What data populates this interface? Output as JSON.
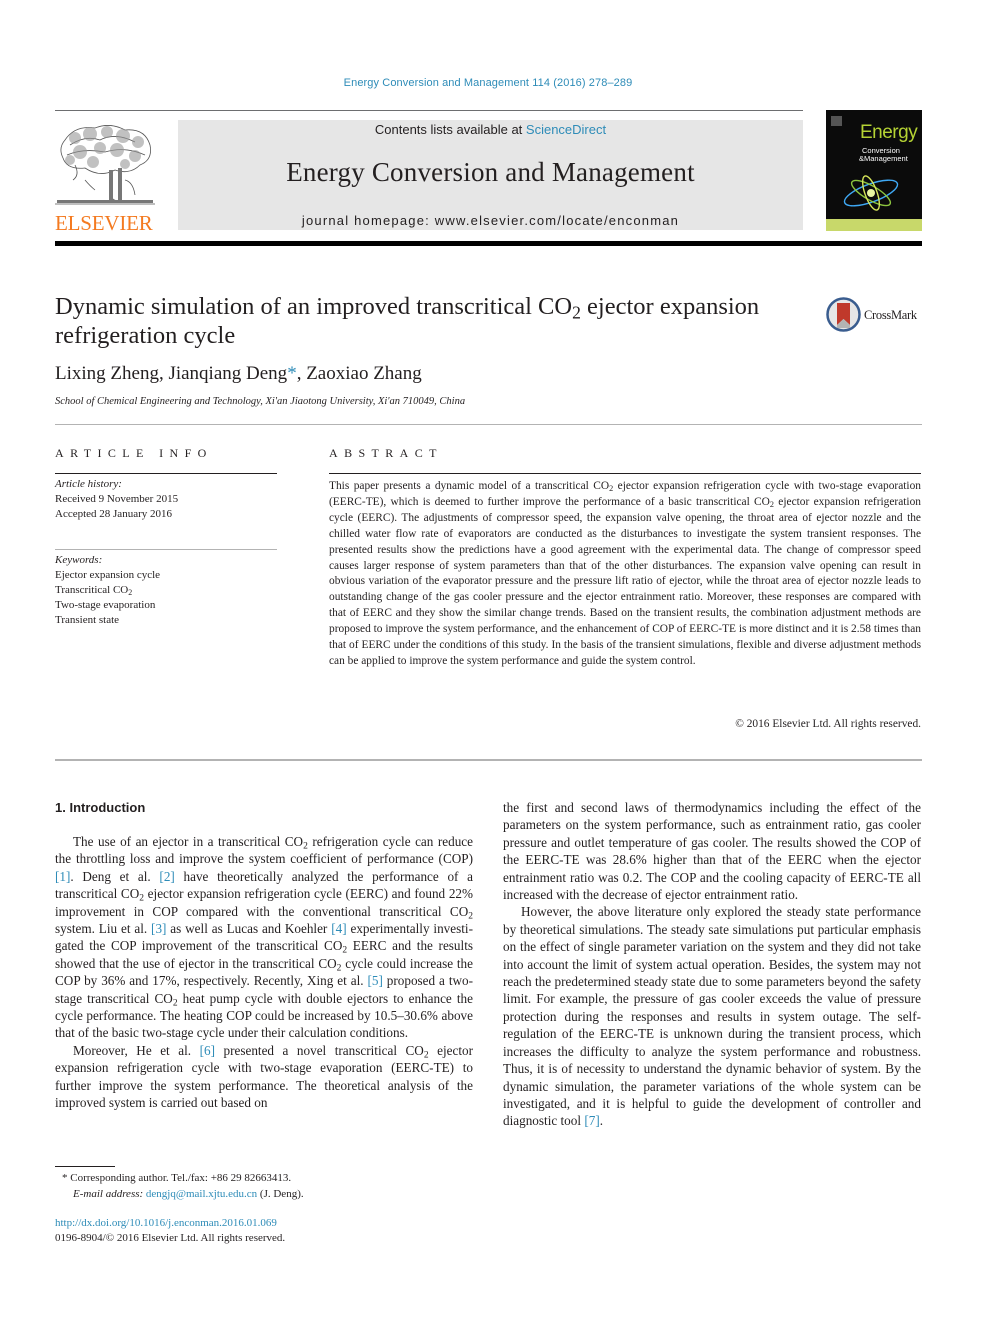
{
  "header": {
    "citation": "Energy Conversion and Management 114 (2016) 278–289",
    "publisher": "ELSEVIER",
    "contents_prefix": "Contents lists available at ",
    "contents_link": "ScienceDirect",
    "journal_name": "Energy Conversion and Management",
    "homepage_prefix": "journal homepage: ",
    "homepage_url": "www.elsevier.com/locate/enconman",
    "cover": {
      "title": "Energy",
      "subtitle_1": "Conversion",
      "subtitle_2": "&Management"
    },
    "colors": {
      "link": "#2e8cb8",
      "elsevier_orange": "#f47a20",
      "masthead_bg": "#e6e6e6"
    }
  },
  "article": {
    "title_part1": "Dynamic simulation of an improved transcritical CO",
    "title_sub": "2",
    "title_part2": " ejector expansion refrigeration cycle",
    "crossmark_label": "CrossMark",
    "authors": {
      "a1": "Lixing Zheng, ",
      "a2": "Jianqiang Deng",
      "a2_mark": "*",
      "a3": ", Zaoxiao Zhang"
    },
    "affiliation": "School of Chemical Engineering and Technology, Xi'an Jiaotong University, Xi'an 710049, China"
  },
  "article_info": {
    "heading": "ARTICLE INFO",
    "history_label": "Article history:",
    "received": "Received 9 November 2015",
    "accepted": "Accepted 28 January 2016",
    "keywords_label": "Keywords:",
    "keywords": [
      "Ejector expansion cycle",
      "Transcritical CO",
      "Two-stage evaporation",
      "Transient state"
    ],
    "keyword_2_sub": "2"
  },
  "abstract": {
    "heading": "ABSTRACT",
    "p1": "This paper presents a dynamic model of a transcritical CO",
    "p2": " ejector expansion refrigeration cycle with two-stage evaporation (EERC-TE), which is deemed to further improve the performance of a basic tran­scritical CO",
    "p3": " ejector expansion refrigeration cycle (EERC). The adjustments of compressor speed, the expansion valve opening, the throat area of ejector nozzle and the chilled water flow rate of evaporators are conducted as the disturbances to investigate the system transient responses. The presented results show the predictions have a good agreement with the experimental data. The change of compressor speed causes larger response of system parameters than that of the other disturbances. The expansion valve opening can result in obvious variation of the evaporator pressure and the pressure lift ratio of ejec­tor, while the throat area of ejector nozzle leads to outstanding change of the gas cooler pressure and the ejector entrainment ratio. Moreover, these responses are compared with that of EERC and they show the similar change trends. Based on the transient results, the combination adjustment methods are proposed to improve the system performance, and the enhancement of COP of EERC-TE is more distinct and it is 2.58 times than that of EERC under the conditions of this study. In the basis of the transient simulations, flexible and diverse adjustment methods can be applied to improve the system performance and guide the system control.",
    "sub": "2",
    "copyright": "© 2016 Elsevier Ltd. All rights reserved."
  },
  "intro": {
    "heading": "1. Introduction",
    "left": {
      "s1": "The use of an ejector in a transcritical CO",
      "s2": " refrigeration cycle can reduce the throttling loss and improve the system coefficient of performance (COP) ",
      "r1": "[1]",
      "s3": ". Deng et al. ",
      "r2": "[2]",
      "s4": " have theoretically ana­lyzed the performance of a transcritical CO",
      "s5": " ejector expansion refrigeration cycle (EERC) and found 22% improvement in COP compared with the conventional transcritical CO",
      "s6": " system. Liu et al. ",
      "r3": "[3]",
      "s7": " as well as Lucas and Koehler ",
      "r4": "[4]",
      "s8": " experimentally investi­gated the COP improvement of the transcritical CO",
      "s9": " EERC and the results showed that the use of ejector in the transcritical CO",
      "s10": " cycle could increase the COP by 36% and 17%, respectively. Recently, Xing et al. ",
      "r5": "[5]",
      "s11": " proposed a two-stage transcritical CO",
      "s12": " heat pump cycle with double ejectors to enhance the cycle performance. The heating COP could be increased by 10.5–30.6% above that of the basic two-stage cycle under their calculation conditions.",
      "p2_s1": "Moreover, He et al. ",
      "r6": "[6]",
      "p2_s2": " presented a novel transcritical CO",
      "p2_s3": " ejec­tor expansion refrigeration cycle with two-stage evaporation (EERC-TE) to further improve the system performance. The theo­retical analysis of the improved system is carried out based on",
      "sub": "2"
    },
    "right": {
      "p1": "the first and second laws of thermodynamics including the effect of the parameters on the system performance, such as entrainment ratio, gas cooler pressure and outlet temperature of gas cooler. The results showed the COP of the EERC-TE was 28.6% higher than that of the EERC when the ejector entrainment ratio was 0.2. The COP and the cooling capacity of EERC-TE all increased with the decrease of ejector entrainment ratio.",
      "p2": "However, the above literature only explored the steady state performance by theoretical simulations. The steady sate simu­lations put particular emphasis on the effect of single parame­ter variation on the system and they did not take into account the limit of system actual operation. Besides, the system may not reach the predetermined steady state due to some param­eters beyond the safety limit. For example, the pressure of gas cooler exceeds the value of pressure protection during the responses and results in system outage. The self-regulation of the EERC-TE is unknown during the transient process, which increases the difficulty to analyze the system performance and robustness. Thus, it is of necessity to understand the dynamic behavior of system. By the dynamic simulation, the parameter variations of the whole system can be investigated, and it is helpful to guide the development of controller and diagnostic tool ",
      "r7": "[7]",
      "end": "."
    }
  },
  "footnote": {
    "mark": "*",
    "text": " Corresponding author. Tel./fax: +86 29 82663413.",
    "email_label": "E-mail address: ",
    "email": "dengjq@mail.xjtu.edu.cn",
    "email_suffix": " (J. Deng)."
  },
  "doi": {
    "url": "http://dx.doi.org/10.1016/j.enconman.2016.01.069",
    "issn_line": "0196-8904/© 2016 Elsevier Ltd. All rights reserved."
  }
}
